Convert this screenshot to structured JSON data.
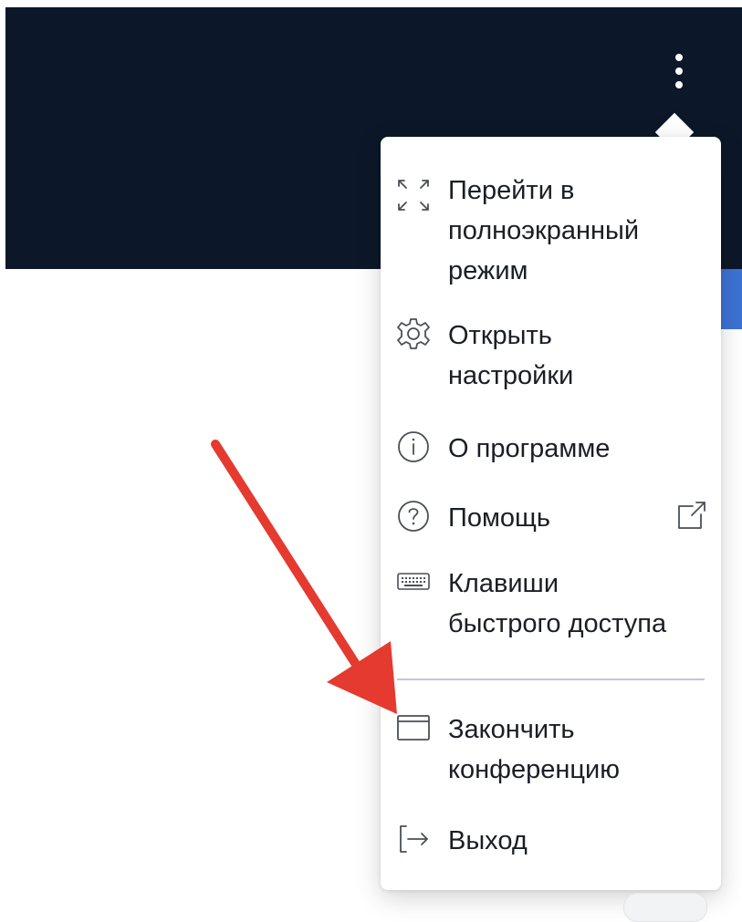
{
  "colors": {
    "top_bar": "#0c1829",
    "accent": "#3d73d6",
    "menu_text": "#1b1e24",
    "annotation_arrow": "#e53a2f"
  },
  "menu": {
    "items": [
      {
        "label_lines": [
          "Перейти в",
          "полноэкранный",
          "режим"
        ],
        "icon": "fullscreen-icon"
      },
      {
        "label_lines": [
          "Открыть",
          "настройки"
        ],
        "icon": "gear-icon"
      },
      {
        "label_lines": [
          "О программе"
        ],
        "icon": "info-icon"
      },
      {
        "label_lines": [
          "Помощь"
        ],
        "icon": "help-icon",
        "trailing_icon": "external-link-icon"
      },
      {
        "label_lines": [
          "Клавиши",
          "быстрого доступа"
        ],
        "icon": "keyboard-icon"
      },
      {
        "label_lines": [
          "Закончить",
          "конференцию"
        ],
        "icon": "window-icon"
      },
      {
        "label_lines": [
          "Выход"
        ],
        "icon": "logout-icon"
      }
    ]
  },
  "top_bar": {
    "menu_button_icon": "kebab-icon"
  },
  "annotation": {
    "icon": "red-arrow-icon"
  }
}
